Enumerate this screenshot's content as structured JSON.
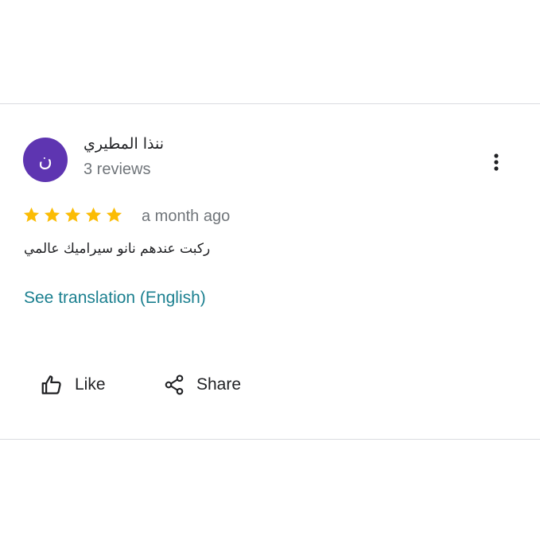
{
  "review": {
    "avatar_initial": "ن",
    "avatar_color": "#5e35b1",
    "reviewer_name": "ننذا المطيري",
    "review_count": "3 reviews",
    "rating": 5,
    "rating_max": 5,
    "star_color": "#fbbc04",
    "date": "a month ago",
    "text": "ركبت عندهم نانو سيراميك عالمي",
    "see_translation_label": "See translation (English)",
    "accent_color": "#1a7f8f",
    "more_icon": "more-vert-icon"
  },
  "actions": {
    "like_label": "Like",
    "like_icon": "thumb-up-icon",
    "share_label": "Share",
    "share_icon": "share-icon"
  }
}
